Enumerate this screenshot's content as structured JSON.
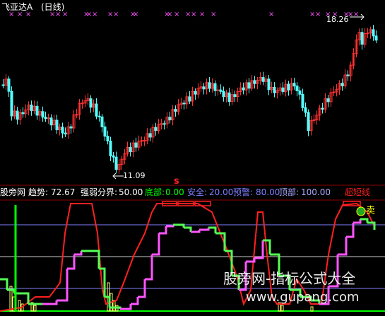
{
  "upper_panel": {
    "stock_label": "飞亚达A",
    "period_label": "(日线)",
    "high_price": "18.26",
    "low_price": "11.09",
    "up_color": "#ff3232",
    "down_color": "#54ffff"
  },
  "lower_panel": {
    "site_name": "股旁网",
    "trend_label": "趋势:",
    "trend_value": "72.67",
    "divide_label": "强弱分界:",
    "divide_value": "50.00",
    "bottom_label": "底部:",
    "bottom_value": "0.00",
    "safe_label": "安全:",
    "safe_value": "20.00",
    "warn_label": "预警:",
    "warn_value": "80.00",
    "top_label": "顶部:",
    "top_value": "100.00",
    "overshort_label": "超短线",
    "sell_label": "卖",
    "s_marker": "s"
  },
  "watermark": {
    "line1": "股旁网-指标公式大全",
    "line2": "www.gupang.com"
  }
}
